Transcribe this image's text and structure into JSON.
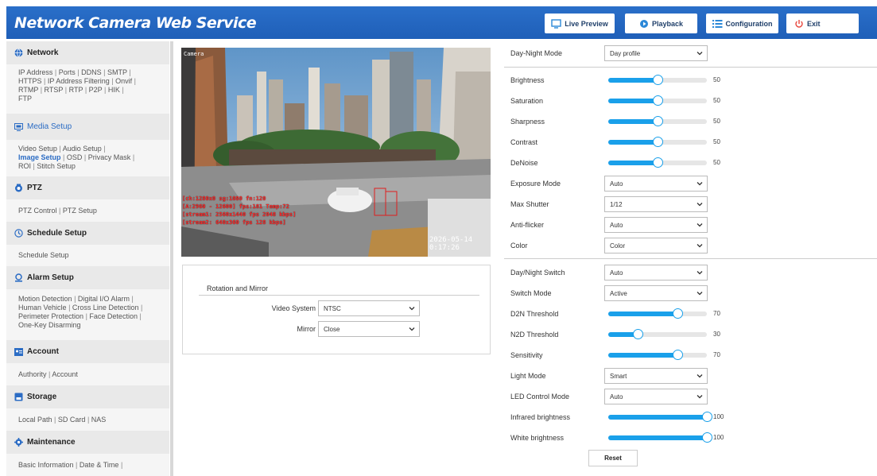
{
  "header": {
    "title": "Network Camera Web Service",
    "buttons": {
      "live_preview": "Live Preview",
      "playback": "Playback",
      "configuration": "Configuration",
      "exit": "Exit"
    }
  },
  "sidebar": {
    "network": {
      "title": "Network",
      "icon": "globe-icon",
      "links": [
        "IP Address",
        "Ports",
        "DDNS",
        "SMTP",
        "HTTPS",
        "IP Address Filtering",
        "Onvif",
        "RTMP",
        "RTSP",
        "RTP",
        "P2P",
        "HIK",
        "FTP"
      ]
    },
    "media": {
      "title": "Media Setup",
      "icon": "monitor-icon",
      "links": [
        "Video Setup",
        "Audio Setup",
        "Image Setup",
        "OSD",
        "Privacy Mask",
        "ROI",
        "Stitch Setup"
      ],
      "active_link": "Image Setup"
    },
    "ptz": {
      "title": "PTZ",
      "icon": "ptz-icon",
      "links": [
        "PTZ Control",
        "PTZ Setup"
      ]
    },
    "schedule": {
      "title": "Schedule Setup",
      "icon": "schedule-icon",
      "links": [
        "Schedule Setup"
      ]
    },
    "alarm": {
      "title": "Alarm Setup",
      "icon": "alarm-icon",
      "links": [
        "Motion Detection",
        "Digital I/O Alarm",
        "Human Vehicle",
        "Cross Line Detection",
        "Perimeter Protection",
        "Face Detection",
        "One-Key Disarming"
      ]
    },
    "account": {
      "title": "Account",
      "icon": "account-icon",
      "links": [
        "Authority",
        "Account"
      ]
    },
    "storage": {
      "title": "Storage",
      "icon": "storage-icon",
      "links": [
        "Local Path",
        "SD Card",
        "NAS"
      ]
    },
    "maintenance": {
      "title": "Maintenance",
      "icon": "gear-icon",
      "links": [
        "Basic Information",
        "Date & Time"
      ]
    }
  },
  "video": {
    "camera_label": "Camera",
    "osd_lines": [
      "[ch:1280x0 sg:1080 fn:120",
      "[A:2960 - 12600] fps:181 Temp:72",
      "[stream1: 2560x1440 fps 2048 kbps]",
      "[stream2: 640x360 fps 128 kbps]"
    ],
    "timestamp": "2026-05-14 0:17:26"
  },
  "rotation": {
    "title": "Rotation and Mirror",
    "video_system_label": "Video System",
    "video_system_value": "NTSC",
    "mirror_label": "Mirror",
    "mirror_value": "Close"
  },
  "settings": {
    "day_night_mode": {
      "label": "Day-Night Mode",
      "value": "Day profile"
    },
    "brightness": {
      "label": "Brightness",
      "value": 50,
      "max": 100
    },
    "saturation": {
      "label": "Saturation",
      "value": 50,
      "max": 100
    },
    "sharpness": {
      "label": "Sharpness",
      "value": 50,
      "max": 100
    },
    "contrast": {
      "label": "Contrast",
      "value": 50,
      "max": 100
    },
    "denoise": {
      "label": "DeNoise",
      "value": 50,
      "max": 100
    },
    "exposure_mode": {
      "label": "Exposure Mode",
      "value": "Auto"
    },
    "max_shutter": {
      "label": "Max Shutter",
      "value": "1/12"
    },
    "anti_flicker": {
      "label": "Anti-flicker",
      "value": "Auto"
    },
    "color": {
      "label": "Color",
      "value": "Color"
    },
    "day_night_switch": {
      "label": "Day/Night Switch",
      "value": "Auto"
    },
    "switch_mode": {
      "label": "Switch Mode",
      "value": "Active"
    },
    "d2n_threshold": {
      "label": "D2N Threshold",
      "value": 70,
      "max": 100
    },
    "n2d_threshold": {
      "label": "N2D Threshold",
      "value": 30,
      "max": 100
    },
    "sensitivity": {
      "label": "Sensitivity",
      "value": 70,
      "max": 100
    },
    "light_mode": {
      "label": "Light Mode",
      "value": "Smart"
    },
    "led_control_mode": {
      "label": "LED Control Mode",
      "value": "Auto"
    },
    "infrared_brightness": {
      "label": "Infrared brightness",
      "value": 100,
      "max": 100
    },
    "white_brightness": {
      "label": "White brightness",
      "value": 100,
      "max": 100
    },
    "reset_label": "Reset"
  },
  "colors": {
    "header": "#2166c1",
    "accent": "#1aa0ea",
    "active_link": "#2b6cc4"
  }
}
